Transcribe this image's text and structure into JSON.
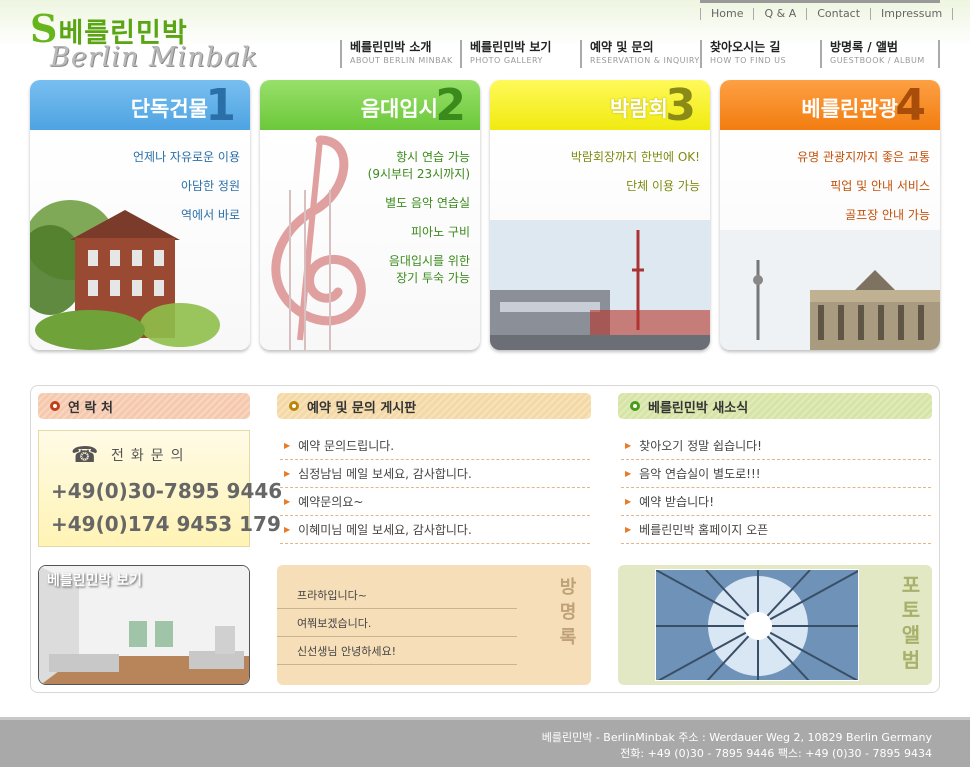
{
  "header": {
    "logo_s": "S",
    "logo_kr": "베를린민박",
    "logo_en": "Berlin Minbak"
  },
  "util_nav": [
    "Home",
    "Q & A",
    "Contact",
    "Impressum"
  ],
  "gnb": [
    {
      "kr": "베를린민박 소개",
      "en": "ABOUT BERLIN MINBAK"
    },
    {
      "kr": "베를린민박 보기",
      "en": "PHOTO GALLERY"
    },
    {
      "kr": "예약 및 문의",
      "en": "RESERVATION & INQUIRY"
    },
    {
      "kr": "찾아오시는 길",
      "en": "HOW TO FIND US"
    },
    {
      "kr": "방명록 / 앨범",
      "en": "GUESTBOOK / ALBUM"
    }
  ],
  "cards": [
    {
      "title": "단독건물",
      "num": "1",
      "head_color": "#5aaee8",
      "num_color": "#2b6fa8",
      "text_color": "#2b6fa8",
      "lines": [
        "언제나 자유로운 이용",
        "아담한 정원",
        "역에서 바로"
      ]
    },
    {
      "title": "음대입시",
      "num": "2",
      "head_color": "#7fd34e",
      "num_color": "#3b8a1c",
      "text_color": "#3b8a1c",
      "lines": [
        "항시 연습 가능",
        "(9시부터 23시까지)",
        "별도 음악 연습실",
        "피아노 구비",
        "음대입시를 위한",
        "장기 투숙 가능"
      ]
    },
    {
      "title": "박람회",
      "num": "3",
      "head_color": "#f4ef1c",
      "num_color": "#8a8a16",
      "text_color": "#7f8a10",
      "lines": [
        "박람회장까지 한번에 OK!",
        "단체 이용 가능"
      ]
    },
    {
      "title": "베를린관광",
      "num": "4",
      "head_color": "#f78a1c",
      "num_color": "#a84d0a",
      "text_color": "#c2510a",
      "lines": [
        "유명 관광지까지 좋은 교통",
        "픽업 및 안내 서비스",
        "골프장 안내 가능"
      ]
    }
  ],
  "contact": {
    "title": "연 락 처",
    "phone_label": "전화문의",
    "phone1": "+49(0)30-7895 9446",
    "phone2": "+49(0)174 9453 179"
  },
  "board": {
    "title": "예약 및 문의 게시판",
    "items": [
      "예약 문의드립니다.",
      "심정남님 메일 보세요, 감사합니다.",
      "예약문의요~",
      "이혜미님 메일 보세요, 감사합니다."
    ]
  },
  "news": {
    "title": "베를린민박 새소식",
    "items": [
      "찾아오기 정말 쉽습니다!",
      "음악 연습실이 별도로!!!",
      "예약 받습니다!",
      "베를린민박 홈페이지 오픈"
    ]
  },
  "photo_view": {
    "label": "베를린민박 보기"
  },
  "guestbook": {
    "label": "방명록",
    "items": [
      "프라하입니다~",
      "여쭤보겠습니다.",
      "신선생님 안녕하세요!"
    ]
  },
  "album": {
    "label": "포토앨범"
  },
  "footer": {
    "line1": "베를린민박 - BerlinMinbak   주소 : Werdauer Weg 2, 10829 Berlin Germany",
    "line2": "전화: +49 (0)30 - 7895 9446  팩스: +49 (0)30 - 7895 9434"
  }
}
